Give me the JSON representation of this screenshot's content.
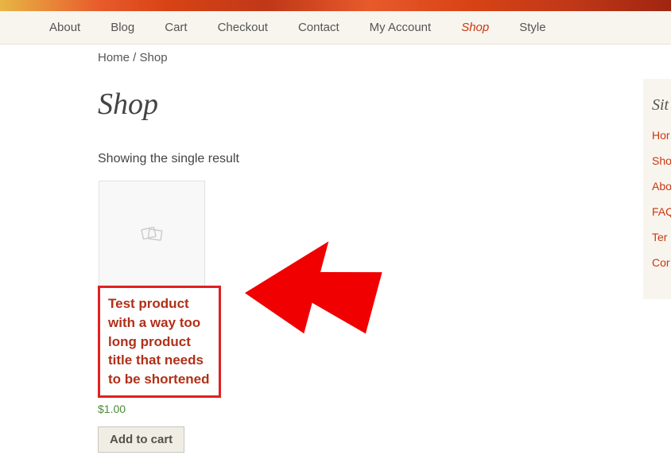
{
  "nav": {
    "items": [
      {
        "label": "About",
        "active": false
      },
      {
        "label": "Blog",
        "active": false
      },
      {
        "label": "Cart",
        "active": false
      },
      {
        "label": "Checkout",
        "active": false
      },
      {
        "label": "Contact",
        "active": false
      },
      {
        "label": "My Account",
        "active": false
      },
      {
        "label": "Shop",
        "active": true
      },
      {
        "label": "Style",
        "active": false
      }
    ]
  },
  "breadcrumb": {
    "home": "Home",
    "separator": " / ",
    "current": "Shop"
  },
  "page": {
    "title": "Shop",
    "result_count": "Showing the single result"
  },
  "product": {
    "title": "Test product with a way too long product title that needs to be shortened",
    "price": "$1.00",
    "add_to_cart": "Add to cart"
  },
  "sidebar": {
    "title": "Sit",
    "links": [
      "Hor",
      "Sho",
      "Abo",
      "FAQ",
      "Ter",
      "Cor"
    ]
  }
}
